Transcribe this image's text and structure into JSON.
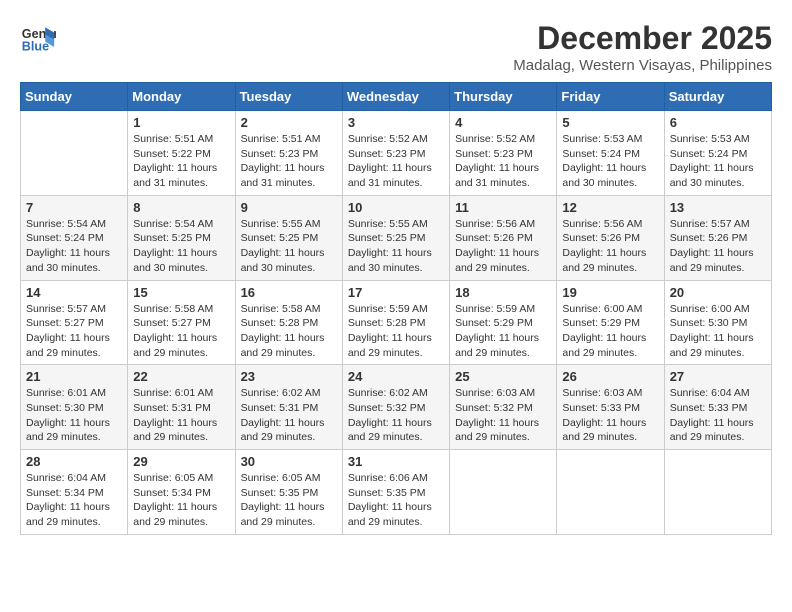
{
  "header": {
    "logo_line1": "General",
    "logo_line2": "Blue",
    "title": "December 2025",
    "subtitle": "Madalag, Western Visayas, Philippines"
  },
  "weekdays": [
    "Sunday",
    "Monday",
    "Tuesday",
    "Wednesday",
    "Thursday",
    "Friday",
    "Saturday"
  ],
  "weeks": [
    [
      {
        "day": "",
        "info": ""
      },
      {
        "day": "1",
        "info": "Sunrise: 5:51 AM\nSunset: 5:22 PM\nDaylight: 11 hours\nand 31 minutes."
      },
      {
        "day": "2",
        "info": "Sunrise: 5:51 AM\nSunset: 5:23 PM\nDaylight: 11 hours\nand 31 minutes."
      },
      {
        "day": "3",
        "info": "Sunrise: 5:52 AM\nSunset: 5:23 PM\nDaylight: 11 hours\nand 31 minutes."
      },
      {
        "day": "4",
        "info": "Sunrise: 5:52 AM\nSunset: 5:23 PM\nDaylight: 11 hours\nand 31 minutes."
      },
      {
        "day": "5",
        "info": "Sunrise: 5:53 AM\nSunset: 5:24 PM\nDaylight: 11 hours\nand 30 minutes."
      },
      {
        "day": "6",
        "info": "Sunrise: 5:53 AM\nSunset: 5:24 PM\nDaylight: 11 hours\nand 30 minutes."
      }
    ],
    [
      {
        "day": "7",
        "info": "Sunrise: 5:54 AM\nSunset: 5:24 PM\nDaylight: 11 hours\nand 30 minutes."
      },
      {
        "day": "8",
        "info": "Sunrise: 5:54 AM\nSunset: 5:25 PM\nDaylight: 11 hours\nand 30 minutes."
      },
      {
        "day": "9",
        "info": "Sunrise: 5:55 AM\nSunset: 5:25 PM\nDaylight: 11 hours\nand 30 minutes."
      },
      {
        "day": "10",
        "info": "Sunrise: 5:55 AM\nSunset: 5:25 PM\nDaylight: 11 hours\nand 30 minutes."
      },
      {
        "day": "11",
        "info": "Sunrise: 5:56 AM\nSunset: 5:26 PM\nDaylight: 11 hours\nand 29 minutes."
      },
      {
        "day": "12",
        "info": "Sunrise: 5:56 AM\nSunset: 5:26 PM\nDaylight: 11 hours\nand 29 minutes."
      },
      {
        "day": "13",
        "info": "Sunrise: 5:57 AM\nSunset: 5:26 PM\nDaylight: 11 hours\nand 29 minutes."
      }
    ],
    [
      {
        "day": "14",
        "info": "Sunrise: 5:57 AM\nSunset: 5:27 PM\nDaylight: 11 hours\nand 29 minutes."
      },
      {
        "day": "15",
        "info": "Sunrise: 5:58 AM\nSunset: 5:27 PM\nDaylight: 11 hours\nand 29 minutes."
      },
      {
        "day": "16",
        "info": "Sunrise: 5:58 AM\nSunset: 5:28 PM\nDaylight: 11 hours\nand 29 minutes."
      },
      {
        "day": "17",
        "info": "Sunrise: 5:59 AM\nSunset: 5:28 PM\nDaylight: 11 hours\nand 29 minutes."
      },
      {
        "day": "18",
        "info": "Sunrise: 5:59 AM\nSunset: 5:29 PM\nDaylight: 11 hours\nand 29 minutes."
      },
      {
        "day": "19",
        "info": "Sunrise: 6:00 AM\nSunset: 5:29 PM\nDaylight: 11 hours\nand 29 minutes."
      },
      {
        "day": "20",
        "info": "Sunrise: 6:00 AM\nSunset: 5:30 PM\nDaylight: 11 hours\nand 29 minutes."
      }
    ],
    [
      {
        "day": "21",
        "info": "Sunrise: 6:01 AM\nSunset: 5:30 PM\nDaylight: 11 hours\nand 29 minutes."
      },
      {
        "day": "22",
        "info": "Sunrise: 6:01 AM\nSunset: 5:31 PM\nDaylight: 11 hours\nand 29 minutes."
      },
      {
        "day": "23",
        "info": "Sunrise: 6:02 AM\nSunset: 5:31 PM\nDaylight: 11 hours\nand 29 minutes."
      },
      {
        "day": "24",
        "info": "Sunrise: 6:02 AM\nSunset: 5:32 PM\nDaylight: 11 hours\nand 29 minutes."
      },
      {
        "day": "25",
        "info": "Sunrise: 6:03 AM\nSunset: 5:32 PM\nDaylight: 11 hours\nand 29 minutes."
      },
      {
        "day": "26",
        "info": "Sunrise: 6:03 AM\nSunset: 5:33 PM\nDaylight: 11 hours\nand 29 minutes."
      },
      {
        "day": "27",
        "info": "Sunrise: 6:04 AM\nSunset: 5:33 PM\nDaylight: 11 hours\nand 29 minutes."
      }
    ],
    [
      {
        "day": "28",
        "info": "Sunrise: 6:04 AM\nSunset: 5:34 PM\nDaylight: 11 hours\nand 29 minutes."
      },
      {
        "day": "29",
        "info": "Sunrise: 6:05 AM\nSunset: 5:34 PM\nDaylight: 11 hours\nand 29 minutes."
      },
      {
        "day": "30",
        "info": "Sunrise: 6:05 AM\nSunset: 5:35 PM\nDaylight: 11 hours\nand 29 minutes."
      },
      {
        "day": "31",
        "info": "Sunrise: 6:06 AM\nSunset: 5:35 PM\nDaylight: 11 hours\nand 29 minutes."
      },
      {
        "day": "",
        "info": ""
      },
      {
        "day": "",
        "info": ""
      },
      {
        "day": "",
        "info": ""
      }
    ]
  ]
}
